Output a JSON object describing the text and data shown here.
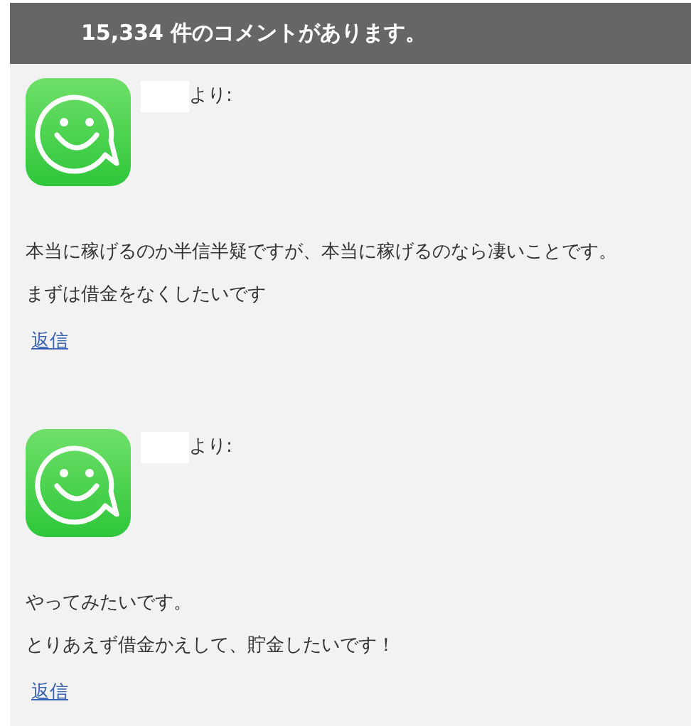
{
  "header": {
    "title": "15,334 件のコメントがあります。"
  },
  "comments": [
    {
      "author_suffix": "より:",
      "paragraphs": [
        "本当に稼げるのか半信半疑ですが、本当に稼げるのなら凄いことです。",
        "まずは借金をなくしたいです"
      ],
      "reply": "返信"
    },
    {
      "author_suffix": "より:",
      "paragraphs": [
        "やってみたいです。",
        "とりあえず借金かえして、貯金したいです！"
      ],
      "reply": "返信"
    }
  ]
}
